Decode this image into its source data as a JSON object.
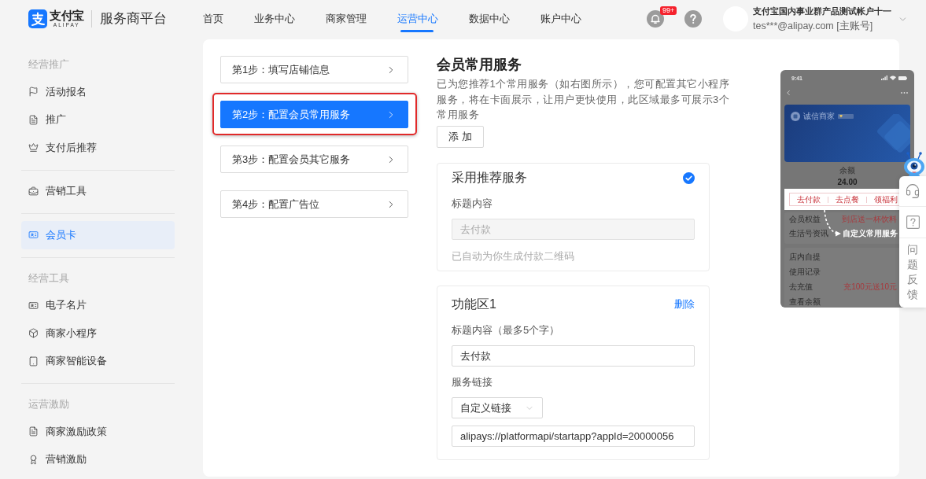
{
  "header": {
    "logo": {
      "name": "支付宝",
      "latin": "ALIPAY"
    },
    "platform": "服务商平台",
    "nav": [
      {
        "label": "首页",
        "selected": false
      },
      {
        "label": "业务中心",
        "selected": false
      },
      {
        "label": "商家管理",
        "selected": false
      },
      {
        "label": "运营中心",
        "selected": true
      },
      {
        "label": "数据中心",
        "selected": false
      },
      {
        "label": "账户中心",
        "selected": false
      }
    ],
    "notifications": {
      "badge": "99+"
    },
    "user": {
      "name": "支付宝国内事业群产品测试帐户十一",
      "account": "tes***@alipay.com [主账号]"
    }
  },
  "sidebar": {
    "sections": [
      {
        "title": "经营推广",
        "items": [
          {
            "label": "活动报名",
            "selected": false
          },
          {
            "label": "推广",
            "selected": false
          },
          {
            "label": "支付后推荐",
            "selected": false
          }
        ]
      },
      {
        "items": [
          {
            "label": "营销工具",
            "selected": false
          }
        ]
      },
      {
        "items": [
          {
            "label": "会员卡",
            "selected": true
          }
        ]
      },
      {
        "title": "经营工具",
        "items": [
          {
            "label": "电子名片",
            "selected": false
          },
          {
            "label": "商家小程序",
            "selected": false
          },
          {
            "label": "商家智能设备",
            "selected": false
          }
        ]
      },
      {
        "title": "运营激励",
        "items": [
          {
            "label": "商家激励政策",
            "selected": false
          },
          {
            "label": "营销激励",
            "selected": false
          }
        ]
      }
    ]
  },
  "steps": [
    {
      "label": "第1步：填写店铺信息",
      "selected": false,
      "highlighted": false
    },
    {
      "label": "第2步：配置会员常用服务",
      "selected": true,
      "highlighted": true
    },
    {
      "label": "第3步：配置会员其它服务",
      "selected": false,
      "highlighted": false
    },
    {
      "label": "第4步：配置广告位",
      "selected": false,
      "highlighted": false
    }
  ],
  "service_config": {
    "title": "会员常用服务",
    "description": "已为您推荐1个常用服务（如右图所示），您可配置其它小程序服务，将在卡面展示，让用户更快使用，此区域最多可展示3个常用服务",
    "add_button": "添 加",
    "recommended": {
      "title": "采用推荐服务",
      "checked": true,
      "field_label": "标题内容",
      "field": {
        "value": "去付款",
        "disabled": true
      },
      "note": "已自动为你生成付款二维码"
    },
    "areas": [
      {
        "title": "功能区1",
        "delete": "删除",
        "name_label": "标题内容（最多5个字）",
        "name_value": "去付款",
        "link_label": "服务链接",
        "link_type": "自定义链接",
        "link_value": "alipays://platformapi/startapp?appId=20000056"
      }
    ]
  },
  "preview": {
    "time": "9:41",
    "merchant": "诚信商家",
    "balance_label": "余额",
    "balance": "24.00",
    "services": [
      "去付款",
      "去点餐",
      "领福利"
    ],
    "rows": [
      {
        "label": "会员权益",
        "value": "到店送一杯饮料"
      },
      {
        "label": "生活号资讯"
      }
    ],
    "callout": "自定义常用服务",
    "more_rows": [
      {
        "label": "店内自提"
      },
      {
        "label": "使用记录"
      },
      {
        "label": "去充值",
        "value": "充100元送10元"
      },
      {
        "label": "查看余额"
      }
    ]
  },
  "float_panel": {
    "feedback": "问题反馈"
  }
}
